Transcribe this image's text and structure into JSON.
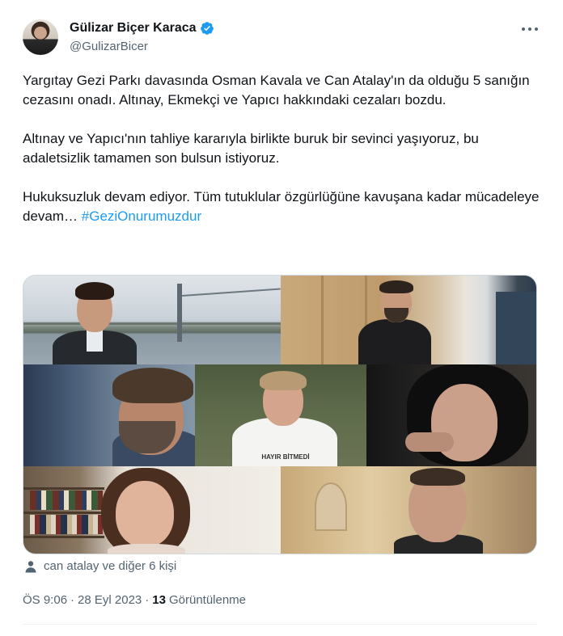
{
  "author": {
    "name": "Gülizar Biçer Karaca",
    "handle": "@GulizarBicer",
    "verified": true
  },
  "tweet": {
    "paragraph_1": "Yargıtay Gezi Parkı davasında Osman Kavala ve Can Atalay'ın da olduğu 5 sanığın cezasını onadı. Altınay, Ekmekçi ve Yapıcı hakkındaki cezaları bozdu.",
    "paragraph_2": "Altınay ve Yapıcı'nın tahliye kararıyla birlikte buruk bir sevinci yaşıyoruz, bu adaletsizlik tamamen son bulsun istiyoruz.",
    "paragraph_3": "Hukuksuzluk devam ediyor. Tüm tutuklular özgürlüğüne kavuşana kadar mücadeleye devam…",
    "hashtag": "#GeziOnurumuzdur"
  },
  "media": {
    "photos": [
      {
        "icon": "photo-man-bridge"
      },
      {
        "icon": "photo-man-office"
      },
      {
        "icon": "photo-man-profile"
      },
      {
        "icon": "photo-woman-smiling"
      },
      {
        "icon": "photo-woman-dark-hair"
      },
      {
        "icon": "photo-woman-bookshelf"
      },
      {
        "icon": "photo-man-smiling"
      }
    ],
    "photo_visible_text": "HAYIR BİTMEDİ"
  },
  "tags": {
    "text": "can atalay ve diğer 6 kişi"
  },
  "meta": {
    "time": "ÖS 9:06",
    "separator": "·",
    "date": "28 Eyl 2023",
    "views_count": "13",
    "views_label": "Görüntülenme"
  },
  "colors": {
    "link": "#1d9bf0",
    "secondary_text": "#536471",
    "verified_badge": "#1d9bf0"
  }
}
